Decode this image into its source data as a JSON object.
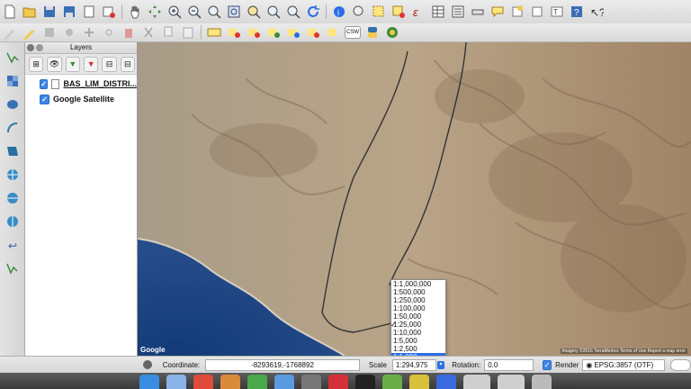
{
  "toolbar1": {
    "icons": [
      "new-project-icon",
      "open-project-icon",
      "save-project-icon",
      "save-as-icon",
      "print-composer-icon",
      "composer-manager-icon",
      "pan-icon",
      "pan-to-selection-icon",
      "zoom-in-icon",
      "zoom-out-icon",
      "zoom-full-icon",
      "zoom-to-selection-icon",
      "zoom-to-layer-icon",
      "zoom-last-icon",
      "zoom-next-icon",
      "refresh-icon",
      "identify-icon",
      "measure-icon",
      "select-icon",
      "deselect-icon",
      "expression-select-icon",
      "attribute-table-icon",
      "field-calculator-icon",
      "statistics-icon",
      "map-tips-icon",
      "new-bookmark-icon",
      "show-bookmarks-icon",
      "text-annotation-icon",
      "help-icon",
      "whats-this-icon"
    ]
  },
  "toolbar2": {
    "icons": [
      "digitize-icon",
      "edit-pencil-icon",
      "save-edits-icon",
      "add-feature-icon",
      "move-feature-icon",
      "node-tool-icon",
      "delete-selected-icon",
      "cut-icon",
      "copy-icon",
      "paste-icon",
      "label-abc-icon",
      "label-pin-icon",
      "label-show-icon",
      "label-move-icon",
      "label-rotate-icon",
      "label-change-icon",
      "label-highlight-icon",
      "csw-label",
      "python-icon",
      "plugin-icon"
    ],
    "csw_label": "CSW"
  },
  "left_tools": {
    "icons": [
      "add-vector-icon",
      "add-raster-icon",
      "add-postgis-icon",
      "add-spatialite-icon",
      "add-mssql-icon",
      "add-wms-icon",
      "add-wcs-icon",
      "add-wfs-icon",
      "add-delimited-icon",
      "new-shapefile-icon"
    ]
  },
  "layers_panel": {
    "title": "Layers",
    "layers": [
      {
        "name": "BAS_LIM_DISTRI...",
        "checked": true
      },
      {
        "name": "Google Satellite",
        "checked": true
      }
    ]
  },
  "map": {
    "google_logo": "Google",
    "attribution": "Imagery ©2016 TerraMetrics   Terms of Use   Report a map error"
  },
  "scale_popup": {
    "options": [
      "1:1,000,000",
      "1:500,000",
      "1:250,000",
      "1:100,000",
      "1:50,000",
      "1:25,000",
      "1:10,000",
      "1:5,000",
      "1:2,500",
      "1:1,000"
    ],
    "checked_index": 5,
    "highlighted_index": 9
  },
  "status": {
    "coordinate_label": "Coordinate:",
    "coordinate_value": "-8293619,-1768892",
    "scale_label": "Scale",
    "scale_value": "1:294,975",
    "rotation_label": "Rotation:",
    "rotation_value": "0.0",
    "render_label": "Render",
    "crs_value": "EPSG:3857 (OTF)"
  },
  "colors": {
    "accent": "#2a6ee6",
    "ocean": "#1a3f7a",
    "desert": "#b5a38a"
  }
}
